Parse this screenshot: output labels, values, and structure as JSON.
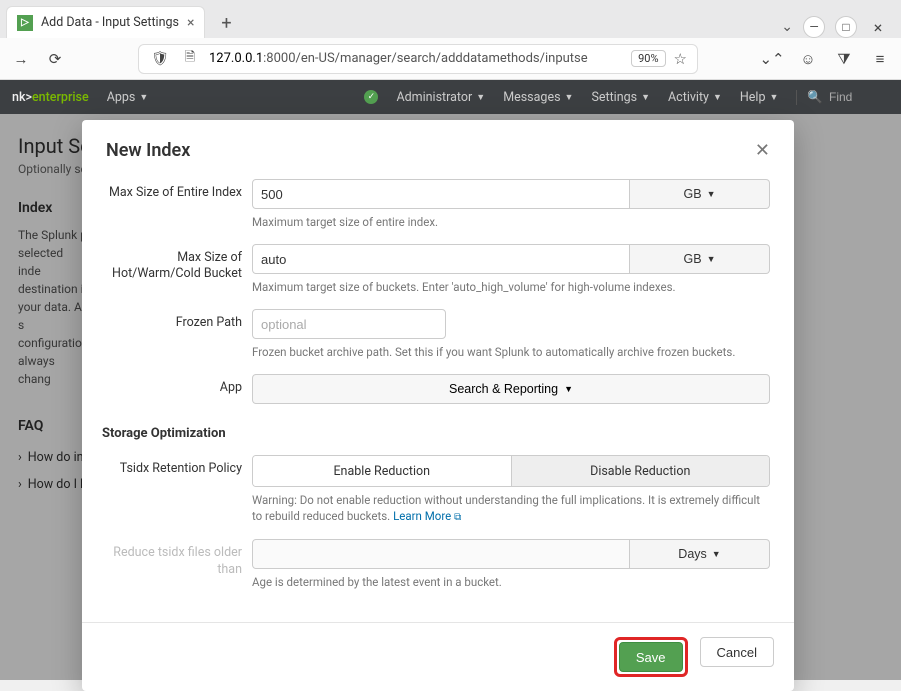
{
  "browser": {
    "tab_title": "Add Data - Input Settings",
    "url_host": "127.0.0.1",
    "url_path": ":8000/en-US/manager/search/adddatamethods/inputse",
    "zoom": "90%"
  },
  "splunk": {
    "brand_prefix": "nk>",
    "brand_suffix": "enterprise",
    "menu_apps": "Apps",
    "menu_admin": "Administrator",
    "menu_messages": "Messages",
    "menu_settings": "Settings",
    "menu_activity": "Activity",
    "menu_help": "Help",
    "search_placeholder": "Find"
  },
  "page": {
    "title": "Input Se",
    "subtitle": "Optionally se",
    "section_index": "Index",
    "index_desc": "The Splunk p selected inde destination if your data. A s configuration always chang",
    "section_faq": "FAQ",
    "faq1": "How do inc",
    "faq2": "How do I k"
  },
  "modal": {
    "title": "New Index",
    "labels": {
      "max_index": "Max Size of Entire Index",
      "max_bucket": "Max Size of Hot/Warm/Cold Bucket",
      "frozen_path": "Frozen Path",
      "app": "App",
      "storage_opt": "Storage Optimization",
      "tsidx": "Tsidx Retention Policy",
      "reduce_age": "Reduce tsidx files older than"
    },
    "values": {
      "max_index": "500",
      "max_bucket": "auto",
      "frozen_path": "",
      "app_selected": "Search & Reporting",
      "reduce_age": ""
    },
    "placeholders": {
      "frozen_path": "optional"
    },
    "units": {
      "gb": "GB",
      "days": "Days"
    },
    "help": {
      "max_index": "Maximum target size of entire index.",
      "max_bucket": "Maximum target size of buckets. Enter 'auto_high_volume' for high-volume indexes.",
      "frozen_path": "Frozen bucket archive path. Set this if you want Splunk to automatically archive frozen buckets.",
      "tsidx": "Warning: Do not enable reduction without understanding the full implications. It is extremely difficult to rebuild reduced buckets.",
      "learn_more": "Learn More",
      "reduce_age": "Age is determined by the latest event in a bucket."
    },
    "seg": {
      "enable": "Enable Reduction",
      "disable": "Disable Reduction"
    },
    "buttons": {
      "save": "Save",
      "cancel": "Cancel"
    }
  }
}
